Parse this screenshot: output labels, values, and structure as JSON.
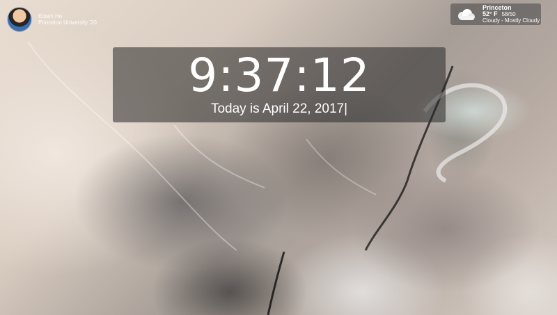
{
  "profile": {
    "name": "Edwin Ho",
    "school": "Princeton University '20"
  },
  "weather": {
    "city": "Princeton",
    "temperature": "52° F",
    "high_low": "58/50",
    "condition": "Cloudy - Mostly Cloudy",
    "icon": "cloud-icon"
  },
  "clock": {
    "time": "9:37:12",
    "date_text": "Today is April 22, 2017",
    "cursor": "|"
  }
}
